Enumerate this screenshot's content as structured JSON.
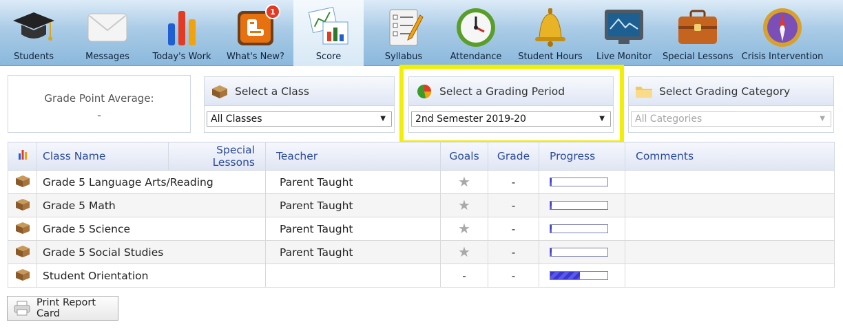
{
  "toolbar": {
    "items": [
      {
        "label": "Students",
        "icon": "graduation-cap-icon"
      },
      {
        "label": "Messages",
        "icon": "envelope-icon"
      },
      {
        "label": "Today's Work",
        "icon": "bar-chart-icon"
      },
      {
        "label": "What's New?",
        "icon": "blogger-icon",
        "badge": "1"
      },
      {
        "label": "Score",
        "icon": "score-charts-icon",
        "active": true
      },
      {
        "label": "Syllabus",
        "icon": "checklist-icon"
      },
      {
        "label": "Attendance",
        "icon": "clock-icon"
      },
      {
        "label": "Student Hours",
        "icon": "bell-icon"
      },
      {
        "label": "Live Monitor",
        "icon": "monitor-icon"
      },
      {
        "label": "Special Lessons",
        "icon": "briefcase-icon"
      },
      {
        "label": "Crisis Intervention",
        "icon": "compass-icon"
      }
    ]
  },
  "gpa": {
    "label": "Grade Point Average:",
    "value": "-"
  },
  "filters": {
    "class": {
      "title": "Select a Class",
      "selected": "All Classes"
    },
    "grading_period": {
      "title": "Select a Grading Period",
      "selected": "2nd Semester 2019-20"
    },
    "category": {
      "title": "Select Grading Category",
      "selected": "All Categories"
    }
  },
  "table": {
    "headers": {
      "class_name": "Class Name",
      "special_lessons": "Special Lessons",
      "teacher": "Teacher",
      "goals": "Goals",
      "grade": "Grade",
      "progress": "Progress",
      "comments": "Comments"
    },
    "rows": [
      {
        "class_name": "Grade 5 Language Arts/Reading",
        "teacher": "Parent Taught",
        "goals": "star",
        "grade": "-",
        "progress": 0.02,
        "comments": ""
      },
      {
        "class_name": "Grade 5 Math",
        "teacher": "Parent Taught",
        "goals": "star",
        "grade": "-",
        "progress": 0.02,
        "comments": ""
      },
      {
        "class_name": "Grade 5 Science",
        "teacher": "Parent Taught",
        "goals": "star",
        "grade": "-",
        "progress": 0.02,
        "comments": ""
      },
      {
        "class_name": "Grade 5 Social Studies",
        "teacher": "Parent Taught",
        "goals": "star",
        "grade": "-",
        "progress": 0.02,
        "comments": ""
      },
      {
        "class_name": "Student Orientation",
        "teacher": "",
        "goals": "-",
        "grade": "-",
        "progress": 0.52,
        "comments": ""
      }
    ]
  },
  "print_button": {
    "label": "Print Report Card"
  },
  "colors": {
    "highlight": "#f3ef00",
    "header_text": "#2a4a9b",
    "progress_fill": "#3a36d6",
    "badge": "#e23a23"
  }
}
